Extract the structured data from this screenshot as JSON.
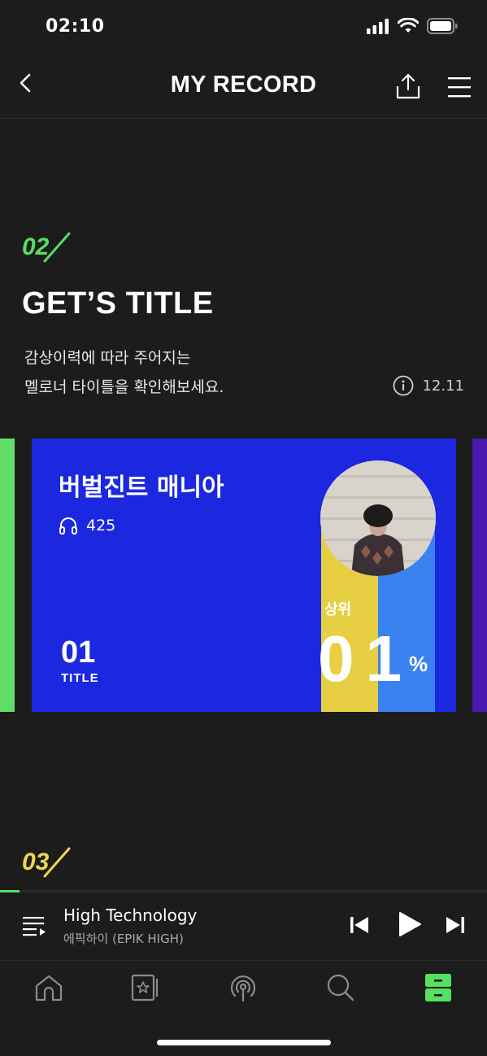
{
  "status_bar": {
    "time": "02:10",
    "icons": [
      "signal-icon",
      "wifi-icon",
      "battery-icon"
    ]
  },
  "header": {
    "title": "MY RECORD",
    "back_icon": "chevron-left-icon",
    "share_icon": "share-icon",
    "menu_icon": "hamburger-menu-icon"
  },
  "section_02": {
    "number": "02",
    "title": "GET’S TITLE",
    "description_line1": "감상이력에 따라 주어지는",
    "description_line2": "멜로너 타이틀을 확인해보세요.",
    "date": "12.11",
    "info_icon": "info-icon"
  },
  "title_card": {
    "name": "버벌진트 매니아",
    "play_count": "425",
    "rank_number": "01",
    "rank_label": "TITLE",
    "percent_label": "상위",
    "percent_value": "01",
    "percent_sign": "%",
    "colors": {
      "card": "#1b28e0",
      "bar_left": "#e7cf44",
      "bar_right": "#3a82f0",
      "peek_left": "#62de68",
      "peek_right": "#4a17b0"
    }
  },
  "section_03": {
    "number": "03"
  },
  "player": {
    "song_title": "High Technology",
    "artist": "에픽하이 (EPIK HIGH)",
    "progress": 0.04,
    "controls": [
      "playlist-icon",
      "previous-icon",
      "play-icon",
      "next-icon"
    ]
  },
  "tabbar": {
    "items": [
      "home-icon",
      "my-music-icon",
      "radio-icon",
      "search-icon",
      "storage-icon"
    ],
    "active": "storage-icon",
    "accent": "#56e05e"
  }
}
